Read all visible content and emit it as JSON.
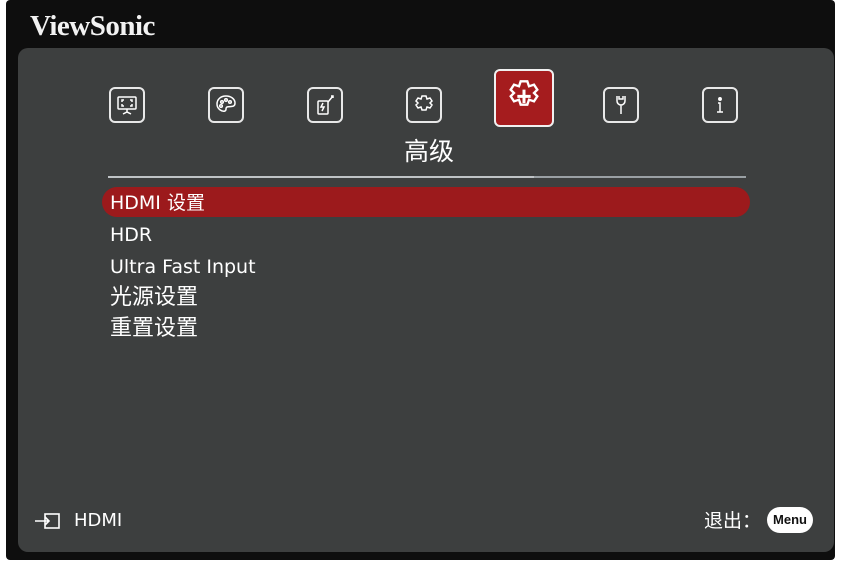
{
  "brand": "ViewSonic",
  "tabs": [
    {
      "icon": "display-icon",
      "active": false
    },
    {
      "icon": "palette-icon",
      "active": false
    },
    {
      "icon": "power-icon",
      "active": false
    },
    {
      "icon": "gear-icon",
      "active": false
    },
    {
      "icon": "advanced-gear-icon",
      "active": true
    },
    {
      "icon": "wrench-icon",
      "active": false
    },
    {
      "icon": "info-icon",
      "active": false
    }
  ],
  "active_tab_label": "高级",
  "menu": {
    "items": [
      {
        "label": "HDMI 设置",
        "selected": true
      },
      {
        "label": "HDR"
      },
      {
        "label": "Ultra Fast Input"
      },
      {
        "label": "光源设置"
      },
      {
        "label": "重置设置"
      }
    ]
  },
  "footer": {
    "source_label": "HDMI",
    "exit_label": "退出：",
    "menu_badge": "Menu"
  },
  "colors": {
    "highlight": "#9c1a1c",
    "panel": "#3d3f3f",
    "frame": "#0e0e0e",
    "active_tab": "#a51c1e"
  }
}
